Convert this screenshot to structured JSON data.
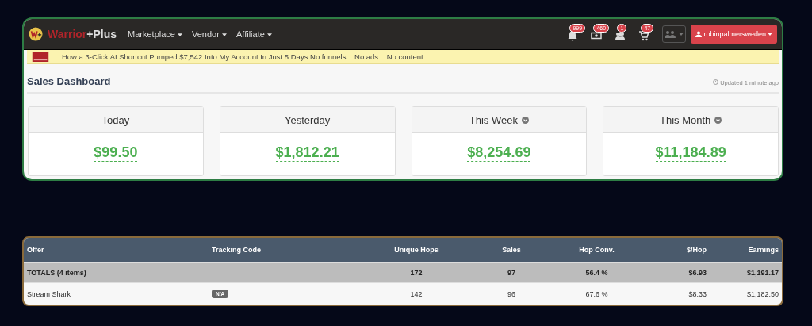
{
  "navbar": {
    "brand_prefix": "Warrior",
    "brand_suffix": "+Plus",
    "menus": [
      {
        "label": "Marketplace"
      },
      {
        "label": "Vendor"
      },
      {
        "label": "Affiliate"
      }
    ],
    "notifications": [
      {
        "kind": "bell",
        "count": "999"
      },
      {
        "kind": "money",
        "count": "460"
      },
      {
        "kind": "people",
        "count": "1"
      },
      {
        "kind": "cart",
        "count": "47"
      }
    ],
    "user": "robinpalmersweden"
  },
  "banner": {
    "text": "...How a 3-Click AI Shortcut Pumped $7,542 Into My Account In Just 5 Days No funnels... No ads... No content..."
  },
  "dashboard": {
    "title": "Sales Dashboard",
    "updated": "Updated 1 minute ago",
    "stats": [
      {
        "label": "Today",
        "value": "$99.50",
        "dropdown": false
      },
      {
        "label": "Yesterday",
        "value": "$1,812.21",
        "dropdown": false
      },
      {
        "label": "This Week",
        "value": "$8,254.69",
        "dropdown": true
      },
      {
        "label": "This Month",
        "value": "$11,184.89",
        "dropdown": true
      }
    ]
  },
  "table": {
    "columns": [
      "Offer",
      "Tracking Code",
      "Unique Hops",
      "Sales",
      "Hop Conv.",
      "$/Hop",
      "Earnings"
    ],
    "rows": [
      {
        "kind": "totals",
        "cells": [
          "TOTALS (4 items)",
          "",
          "172",
          "97",
          "56.4 %",
          "$6.93",
          "$1,191.17"
        ]
      },
      {
        "kind": "item",
        "cells": [
          "Stream Shark",
          "N/A",
          "142",
          "96",
          "67.6 %",
          "$8.33",
          "$1,182.50"
        ]
      }
    ]
  }
}
